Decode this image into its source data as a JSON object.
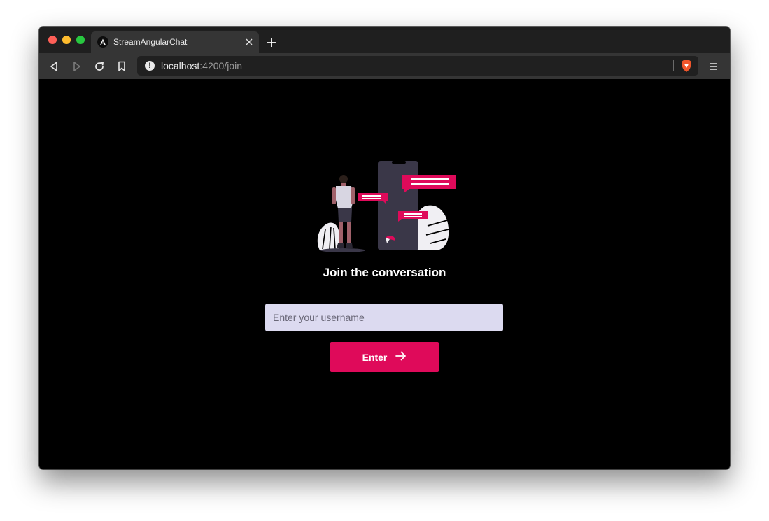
{
  "browser": {
    "tab_title": "StreamAngularChat",
    "url_host": "localhost",
    "url_path": ":4200/join",
    "icons": {
      "favicon": "angular-icon",
      "tab_close": "close-icon",
      "new_tab": "plus-icon",
      "back": "back-icon",
      "forward": "forward-icon",
      "reload": "reload-icon",
      "bookmark": "bookmark-icon",
      "site_info": "info-icon",
      "shields": "brave-shield-icon",
      "menu": "hamburger-menu-icon"
    }
  },
  "page": {
    "heading": "Join the conversation",
    "username_placeholder": "Enter your username",
    "username_value": "",
    "enter_label": "Enter",
    "enter_icon": "arrow-right-icon"
  },
  "colors": {
    "accent": "#df0a5a",
    "input_bg": "#dcdaf0",
    "page_bg": "#000000"
  }
}
